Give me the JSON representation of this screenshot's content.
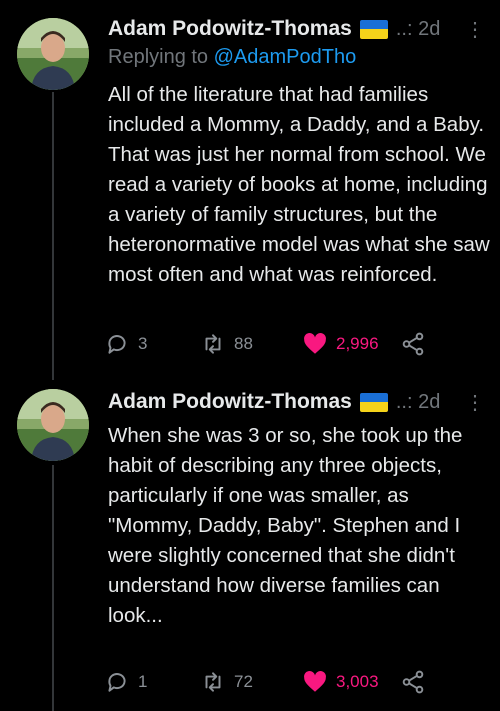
{
  "tweets": [
    {
      "author": "Adam Podowitz-Thomas",
      "meta": "..: 2d",
      "more": "⋮",
      "reply_prefix": "Replying to",
      "reply_handle": "@AdamPodTho",
      "text": "All of the literature that had families included a Mommy, a Daddy, and a Baby. That was just her normal from school. We read a variety of books at home, including a variety of family structures, but the heteronormative model was what she saw most often and what was  reinforced.",
      "replies": "3",
      "retweets": "88",
      "likes": "2,996"
    },
    {
      "author": "Adam Podowitz-Thomas",
      "meta": "..: 2d",
      "more": "⋮",
      "text": "When she was 3 or so, she took up the habit of describing any three objects, particularly if one was smaller, as \"Mommy, Daddy, Baby\". Stephen and I were slightly concerned that she didn't understand how diverse families can look...",
      "replies": "1",
      "retweets": "72",
      "likes": "3,003"
    }
  ],
  "colors": {
    "background": "#000000",
    "text": "#e7e9ea",
    "muted": "#71767b",
    "link": "#1d9bf0",
    "like": "#f91880",
    "thread_line": "#333639"
  },
  "icons": [
    "avatar",
    "ukraine-flag-icon",
    "reply-icon",
    "retweet-icon",
    "heart-icon",
    "share-icon",
    "more-icon"
  ]
}
